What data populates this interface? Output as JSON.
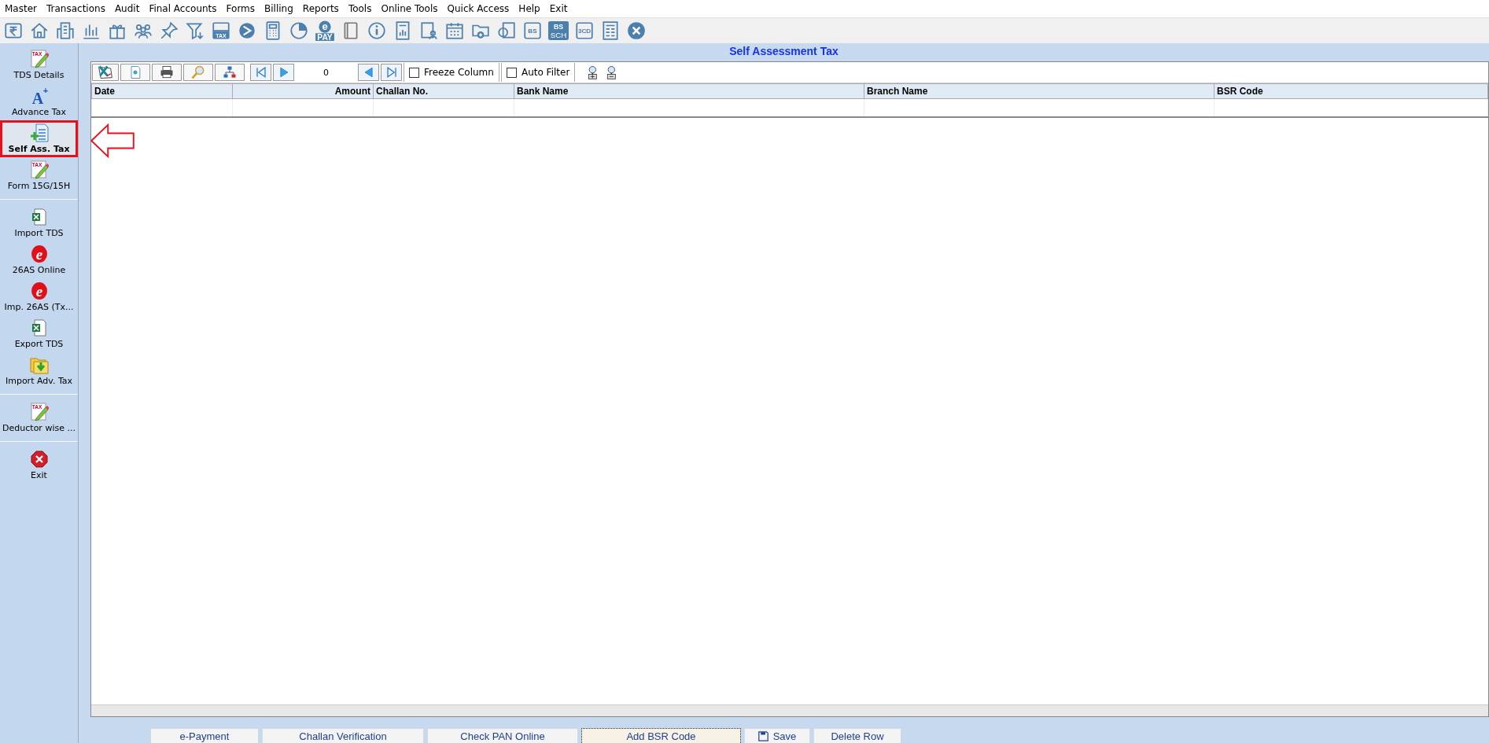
{
  "menu": [
    "Master",
    "Transactions",
    "Audit",
    "Final Accounts",
    "Forms",
    "Billing",
    "Reports",
    "Tools",
    "Online Tools",
    "Quick Access",
    "Help",
    "Exit"
  ],
  "toolbar": [
    {
      "kind": "rupee"
    },
    {
      "kind": "house"
    },
    {
      "kind": "building"
    },
    {
      "kind": "bars"
    },
    {
      "kind": "gift"
    },
    {
      "kind": "people"
    },
    {
      "kind": "pin"
    },
    {
      "kind": "filter"
    },
    {
      "kind": "tax",
      "texts": [
        "TAX"
      ]
    },
    {
      "kind": "play"
    },
    {
      "kind": "calculator"
    },
    {
      "kind": "pie"
    },
    {
      "kind": "epay",
      "texts": [
        "e",
        "PAY"
      ]
    },
    {
      "kind": "book"
    },
    {
      "kind": "info"
    },
    {
      "kind": "report"
    },
    {
      "kind": "userdoc"
    },
    {
      "kind": "calendar"
    },
    {
      "kind": "folderadd"
    },
    {
      "kind": "window"
    },
    {
      "kind": "badge",
      "texts": [
        "BS"
      ]
    },
    {
      "kind": "badge2",
      "texts": [
        "BS",
        "SCH"
      ]
    },
    {
      "kind": "badge",
      "texts": [
        "3CD"
      ]
    },
    {
      "kind": "sheet"
    },
    {
      "kind": "close"
    }
  ],
  "sidebar": {
    "groups": [
      {
        "items": [
          {
            "label": "TDS Details",
            "kind": "taxpencil",
            "texts": [
              "TAX"
            ],
            "selected": false
          },
          {
            "label": "Advance Tax",
            "kind": "aplus",
            "texts": [
              "A",
              "+"
            ],
            "selected": false
          },
          {
            "label": "Self Ass. Tax",
            "kind": "docplus",
            "selected": true
          },
          {
            "label": "Form 15G/15H",
            "kind": "taxpencil",
            "texts": [
              "TAX"
            ],
            "selected": false
          }
        ]
      },
      {
        "items": [
          {
            "label": "Import TDS",
            "kind": "excel",
            "selected": false
          },
          {
            "label": "26AS Online",
            "kind": "elogo",
            "texts": [
              "e"
            ],
            "selected": false
          },
          {
            "label": "Imp. 26AS (Tx...",
            "kind": "elogo",
            "texts": [
              "e"
            ],
            "selected": false
          },
          {
            "label": "Export TDS",
            "kind": "excel",
            "selected": false
          },
          {
            "label": "Import Adv. Tax",
            "kind": "folderarrow",
            "selected": false
          }
        ]
      },
      {
        "items": [
          {
            "label": "Deductor wise ...",
            "kind": "taxpencil",
            "texts": [
              "TAX"
            ],
            "selected": false
          }
        ]
      },
      {
        "items": [
          {
            "label": "Exit",
            "kind": "stop",
            "selected": false
          }
        ]
      }
    ]
  },
  "title": "Self Assessment Tax",
  "grid_toolbar": {
    "record": "0",
    "checkboxes": [
      {
        "label": "Freeze Column",
        "checked": false
      },
      {
        "label": "Auto Filter",
        "checked": false
      }
    ]
  },
  "table": {
    "columns": [
      {
        "label": "Date"
      },
      {
        "label": "Amount"
      },
      {
        "label": "Challan No."
      },
      {
        "label": "Bank Name"
      },
      {
        "label": "Branch Name"
      },
      {
        "label": "BSR Code"
      }
    ]
  },
  "buttons": [
    {
      "label": "e-Payment",
      "focused": false
    },
    {
      "label": "Challan Verification",
      "focused": false
    },
    {
      "label": "Check PAN Online",
      "focused": false
    },
    {
      "label": "Add BSR Code",
      "focused": true
    },
    {
      "label": "Save",
      "focused": false,
      "kind": "save"
    },
    {
      "label": "Delete Row",
      "focused": false
    }
  ]
}
